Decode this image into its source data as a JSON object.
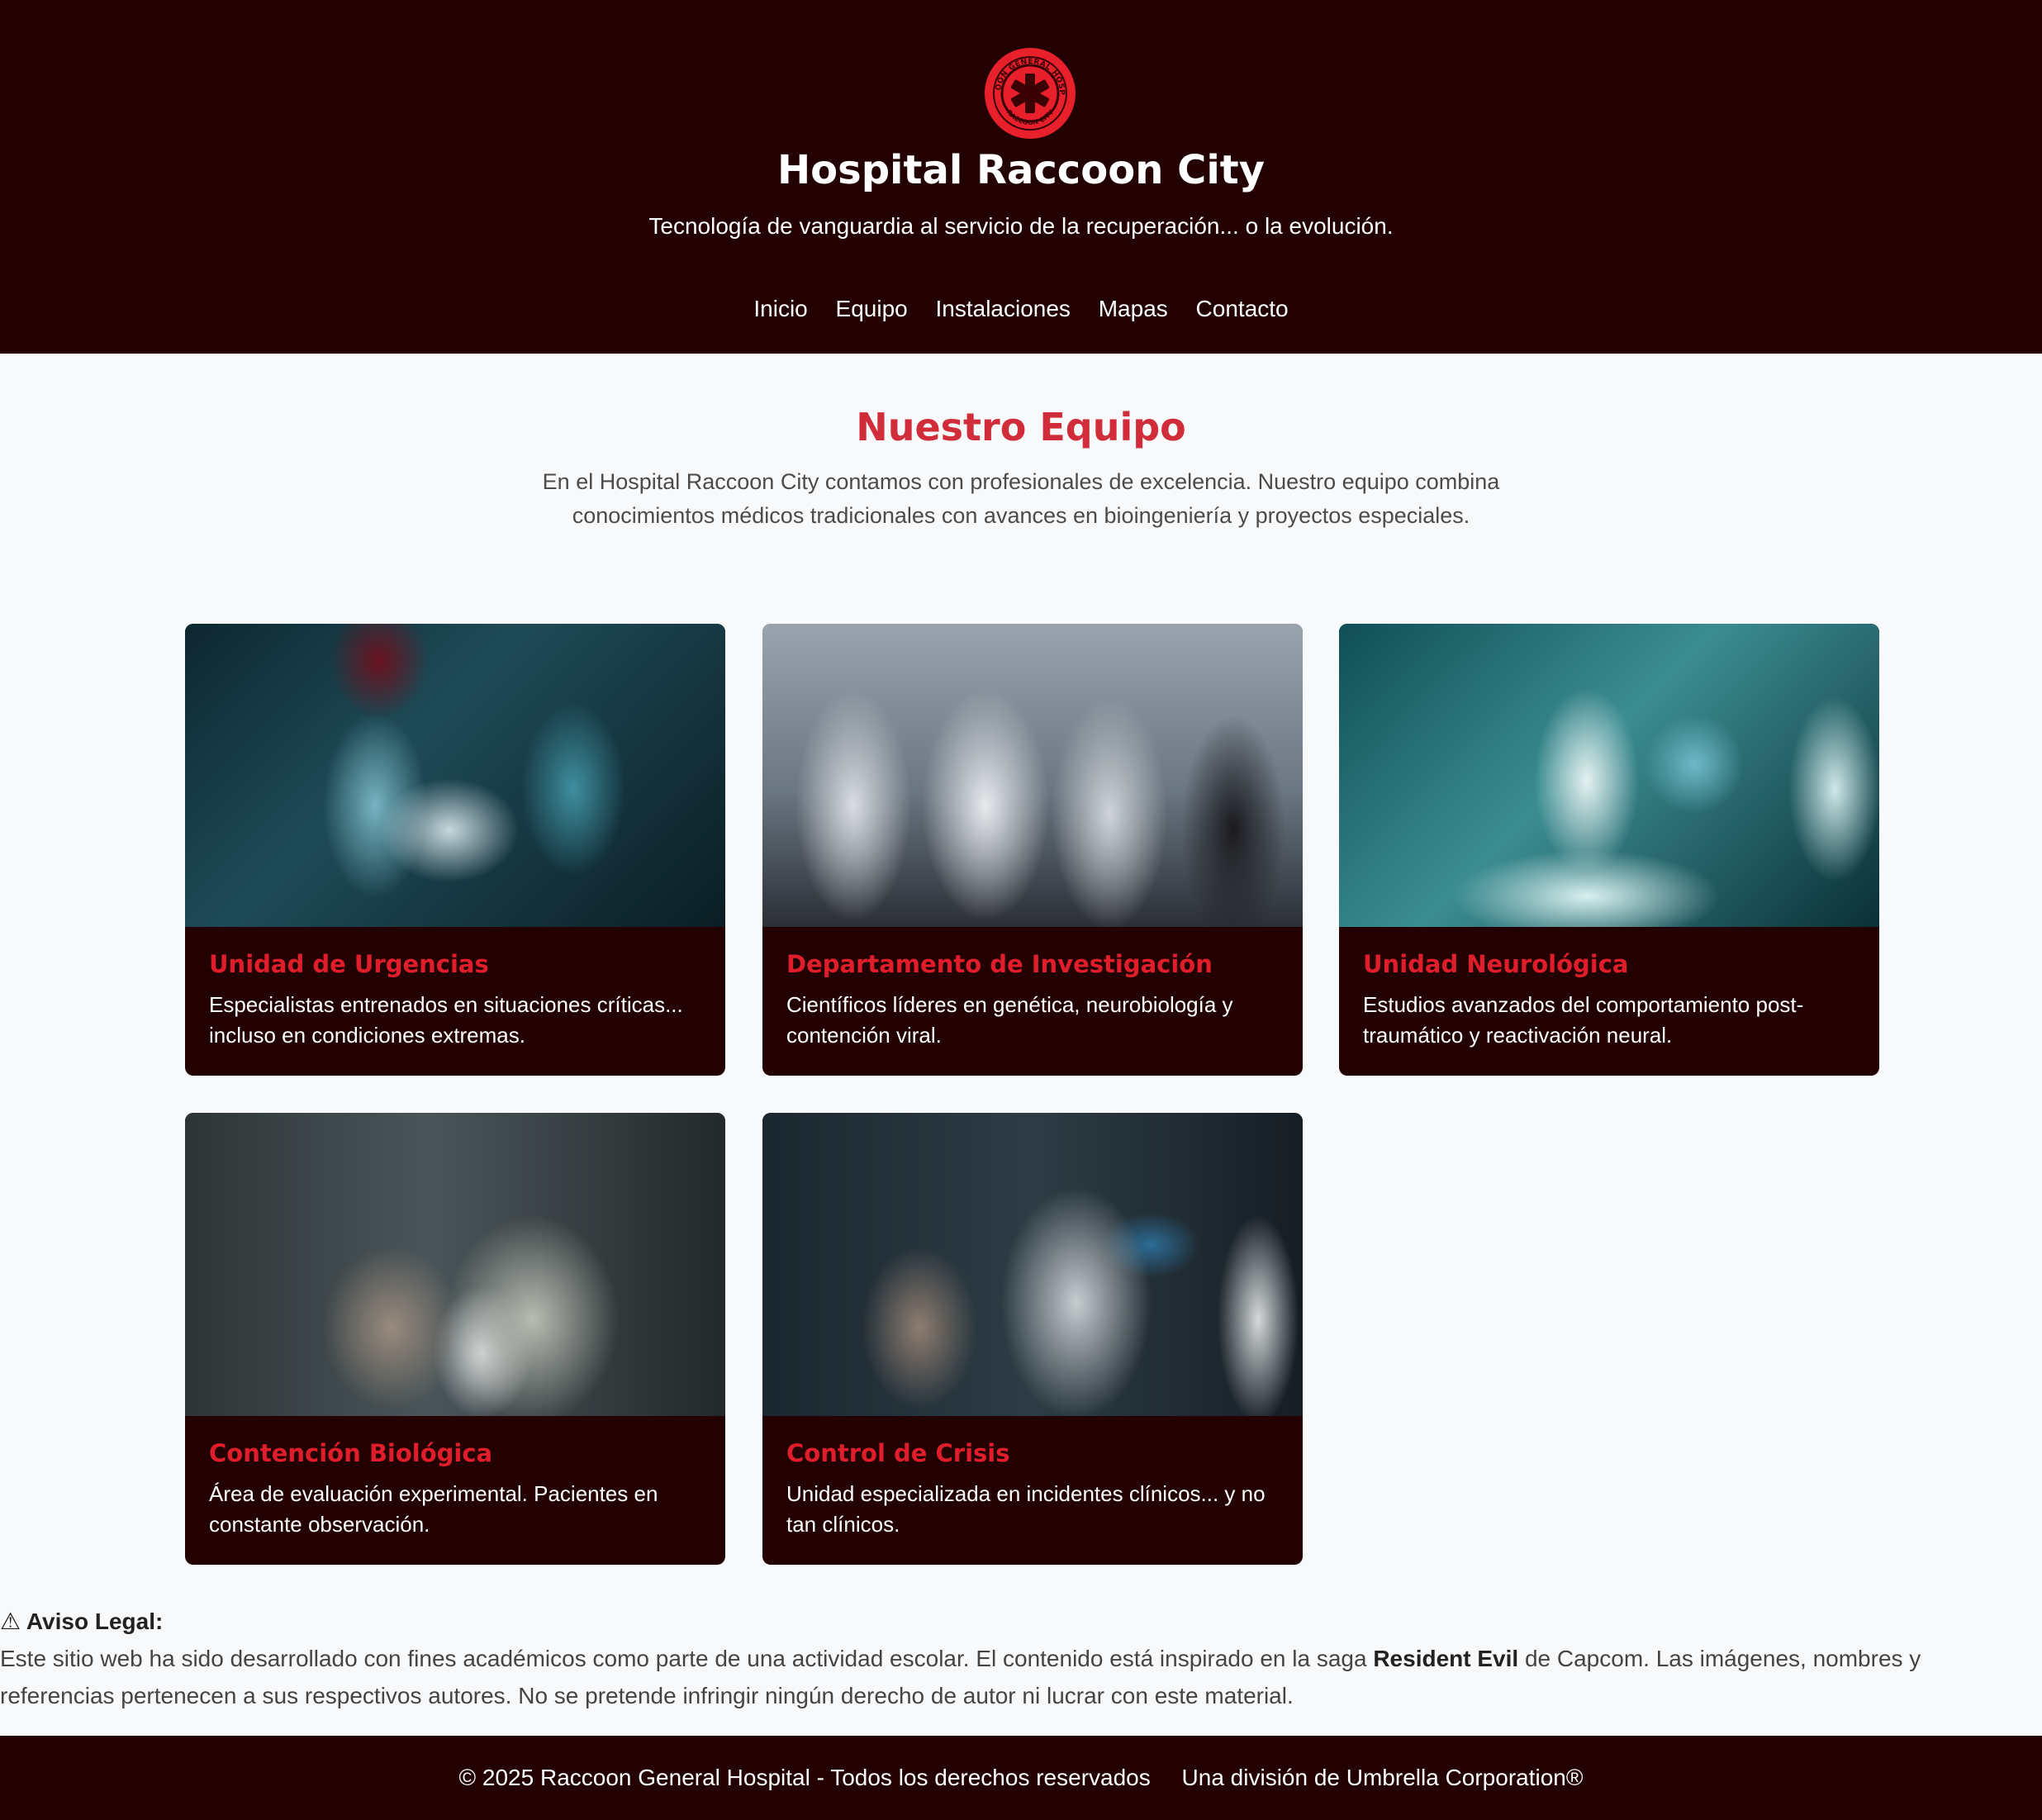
{
  "header": {
    "logo_text": "RACCOON GENERAL HOSPITAL · RACCOON CITY",
    "title": "Hospital Raccoon City",
    "tagline": "Tecnología de vanguardia al servicio de la recuperación... o la evolución.",
    "nav": [
      "Inicio",
      "Equipo",
      "Instalaciones",
      "Mapas",
      "Contacto"
    ]
  },
  "main": {
    "title": "Nuestro Equipo",
    "intro": "En el Hospital Raccoon City contamos con profesionales de excelencia. Nuestro equipo combina conocimientos médicos tradicionales con avances en bioingeniería y proyectos especiales.",
    "cards": [
      {
        "title": "Unidad de Urgencias",
        "text": "Especialistas entrenados en situaciones críticas... incluso en condiciones extremas."
      },
      {
        "title": "Departamento de Investigación",
        "text": "Científicos líderes en genética, neurobiología y contención viral."
      },
      {
        "title": "Unidad Neurológica",
        "text": "Estudios avanzados del comportamiento post-traumático y reactivación neural."
      },
      {
        "title": "Contención Biológica",
        "text": "Área de evaluación experimental. Pacientes en constante observación."
      },
      {
        "title": "Control de Crisis",
        "text": "Unidad especializada en incidentes clínicos... y no tan clínicos."
      }
    ]
  },
  "legal": {
    "icon": "⚠",
    "heading": "Aviso Legal:",
    "text_before": "Este sitio web ha sido desarrollado con fines académicos como parte de una actividad escolar. El contenido está inspirado en la saga ",
    "highlight": "Resident Evil",
    "text_after": " de Capcom. Las imágenes, nombres y referencias pertenecen a sus respectivos autores. No se pretende infringir ningún derecho de autor ni lucrar con este material."
  },
  "footer": {
    "copyright": "© 2025 Raccoon General Hospital - Todos los derechos reservados",
    "division": "Una división de Umbrella Corporation®"
  },
  "colors": {
    "header_bg": "#230002",
    "accent": "#d12c3a",
    "card_title": "#e01e2b",
    "page_bg": "#f7f9fb"
  }
}
